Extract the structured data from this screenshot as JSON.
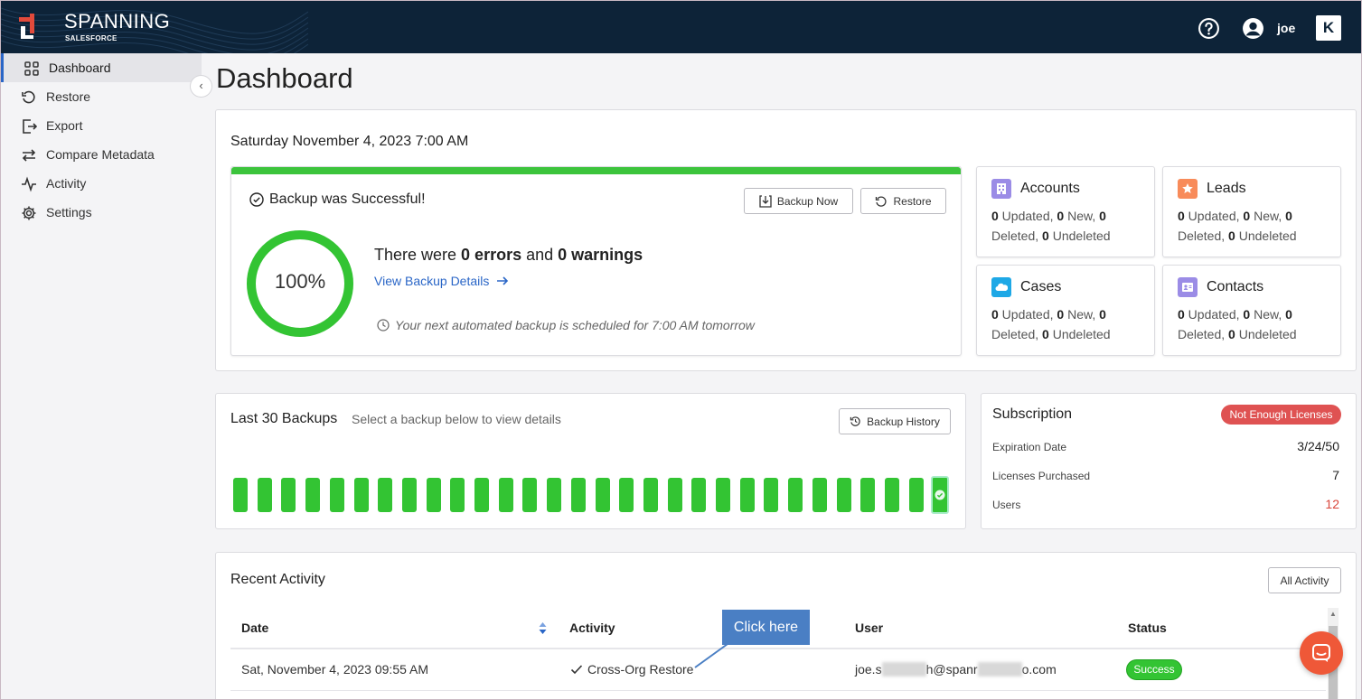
{
  "app": {
    "brand": "SPANNING",
    "brand_sub": "SALESFORCE",
    "user": "joe",
    "badge": "K"
  },
  "sidebar": {
    "items": [
      {
        "label": "Dashboard",
        "icon": "grid-icon",
        "active": true
      },
      {
        "label": "Restore",
        "icon": "restore-icon"
      },
      {
        "label": "Export",
        "icon": "export-icon"
      },
      {
        "label": "Compare Metadata",
        "icon": "compare-icon"
      },
      {
        "label": "Activity",
        "icon": "activity-icon"
      },
      {
        "label": "Settings",
        "icon": "gear-icon"
      }
    ]
  },
  "page": {
    "title": "Dashboard"
  },
  "backup": {
    "date": "Saturday November 4, 2023 7:00 AM",
    "status_text": "Backup was Successful!",
    "backup_now": "Backup Now",
    "restore": "Restore",
    "percent": "100%",
    "percent_value": 1.0,
    "err_prefix": "There were ",
    "errors": "0 errors",
    "err_mid": " and ",
    "warnings": "0 warnings",
    "view_details": "View Backup Details",
    "next_backup": "Your next automated backup is scheduled for 7:00 AM tomorrow"
  },
  "objects": [
    {
      "title": "Accounts",
      "color": "#9b8ce6",
      "updated": "0",
      "new": "0",
      "deleted": "0",
      "undeleted": "0"
    },
    {
      "title": "Leads",
      "color": "#f88b5a",
      "updated": "0",
      "new": "0",
      "deleted": "0",
      "undeleted": "0"
    },
    {
      "title": "Cases",
      "color": "#1ea8e6",
      "updated": "0",
      "new": "0",
      "deleted": "0",
      "undeleted": "0"
    },
    {
      "title": "Contacts",
      "color": "#9b8ce6",
      "updated": "0",
      "new": "0",
      "deleted": "0",
      "undeleted": "0"
    }
  ],
  "obj_labels": {
    "updated": " Updated, ",
    "new": " New, ",
    "deleted": "Deleted, ",
    "undeleted": " Undeleted"
  },
  "last30": {
    "title": "Last 30 Backups",
    "subtitle": "Select a backup below to view details",
    "history_button": "Backup History",
    "count": 30,
    "status_color": "#33c433"
  },
  "subscription": {
    "title": "Subscription",
    "badge": "Not Enough Licenses",
    "rows": [
      {
        "label": "Expiration Date",
        "value": "3/24/50"
      },
      {
        "label": "Licenses Purchased",
        "value": "7"
      },
      {
        "label": "Users",
        "value": "12"
      }
    ]
  },
  "recent": {
    "title": "Recent Activity",
    "all_button": "All Activity",
    "columns": [
      "Date",
      "Activity",
      "User",
      "Status"
    ],
    "rows": [
      {
        "date": "Sat, November 4, 2023 09:55 AM",
        "activity": "Cross-Org Restore",
        "user_a": "joe.s",
        "user_b": "h@spanr",
        "user_c": "o.com",
        "status": "Success"
      }
    ]
  },
  "callout": {
    "text": "Click here"
  }
}
